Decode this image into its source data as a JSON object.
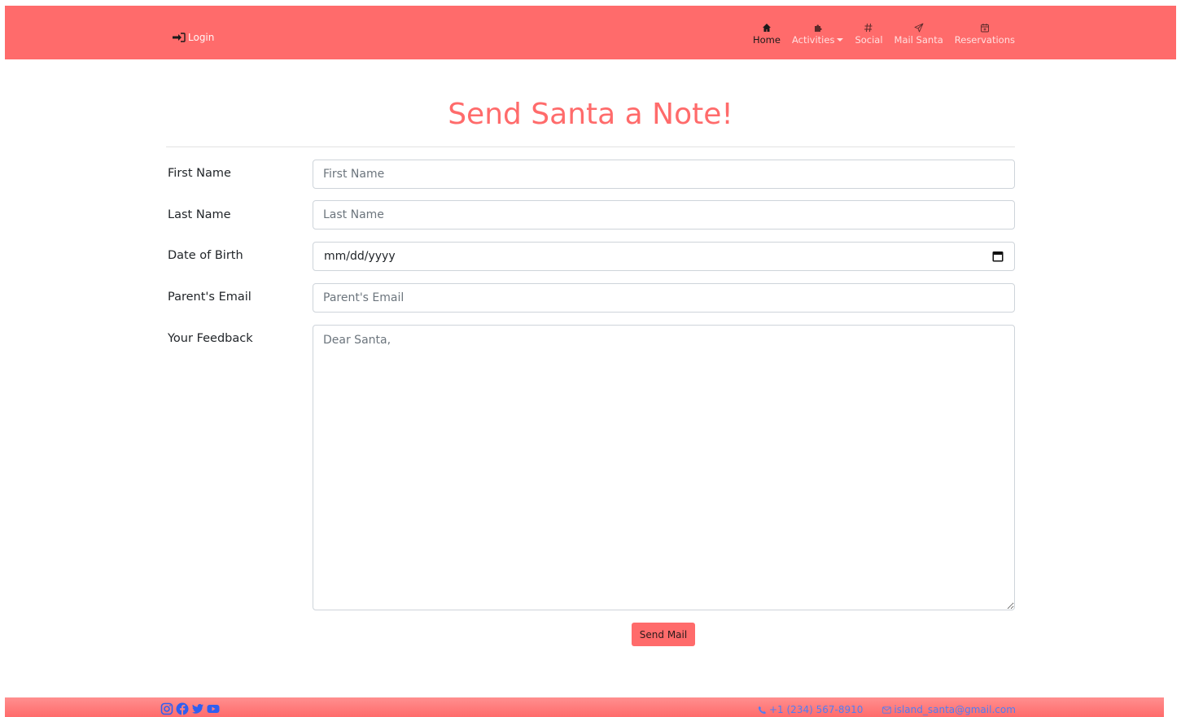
{
  "navbar": {
    "login_label": "Login",
    "items": [
      {
        "label": "Home",
        "icon": "home-icon",
        "active": true
      },
      {
        "label": "Activities",
        "icon": "puzzle-icon",
        "dropdown": true
      },
      {
        "label": "Social",
        "icon": "hash-icon"
      },
      {
        "label": "Mail Santa",
        "icon": "paper-plane-icon"
      },
      {
        "label": "Reservations",
        "icon": "calendar-icon"
      }
    ],
    "background": "#ff6b6b"
  },
  "page": {
    "title": "Send Santa a Note!",
    "title_color": "#ff6b6b"
  },
  "form": {
    "first_name": {
      "label": "First Name",
      "placeholder": "First Name"
    },
    "last_name": {
      "label": "Last Name",
      "placeholder": "Last Name"
    },
    "dob": {
      "label": "Date of Birth",
      "placeholder": "mm/dd/yyyy"
    },
    "parent_email": {
      "label": "Parent's Email",
      "placeholder": "Parent's Email"
    },
    "feedback": {
      "label": "Your Feedback",
      "placeholder": "Dear Santa,"
    },
    "submit_label": "Send Mail"
  },
  "footer": {
    "social_icons": [
      "instagram-icon",
      "facebook-icon",
      "twitter-icon",
      "youtube-icon"
    ],
    "phone": "+1 (234) 567-8910",
    "email": "island_santa@gmail.com",
    "link_color": "#4e7df5"
  }
}
